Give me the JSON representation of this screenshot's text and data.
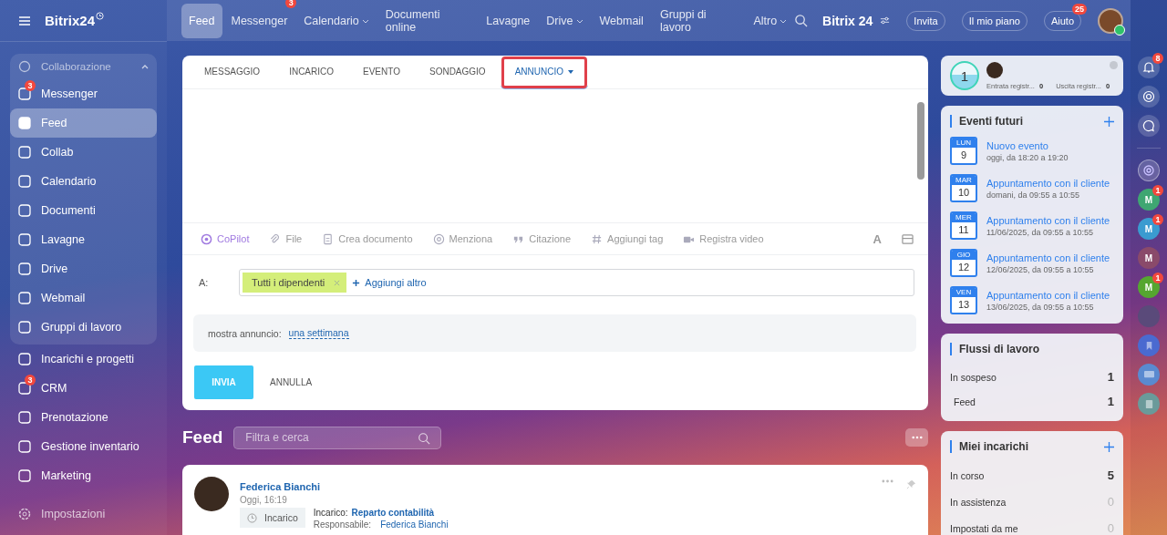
{
  "logo": {
    "text": "Bitrix24"
  },
  "top_nav": [
    {
      "label": "Feed",
      "selected": true
    },
    {
      "label": "Messenger",
      "selected": false,
      "badge": "3"
    },
    {
      "label": "Calendario",
      "selected": false,
      "dropdown": true
    },
    {
      "label": "Documenti online",
      "selected": false
    },
    {
      "label": "Lavagne",
      "selected": false
    },
    {
      "label": "Drive",
      "selected": false,
      "dropdown": true
    },
    {
      "label": "Webmail",
      "selected": false
    },
    {
      "label": "Gruppi di lavoro",
      "selected": false
    },
    {
      "label": "Altro",
      "selected": false,
      "dropdown": true
    }
  ],
  "header": {
    "brand": "Bitrix 24",
    "buttons": [
      {
        "label": "Invita"
      },
      {
        "label": "Il mio piano"
      },
      {
        "label": "Aiuto",
        "badge": "25"
      }
    ]
  },
  "sidebar": {
    "group": {
      "label": "Collaborazione",
      "expanded": true,
      "items": [
        {
          "label": "Messenger",
          "selected": false,
          "badge": "3"
        },
        {
          "label": "Feed",
          "selected": true
        },
        {
          "label": "Collab",
          "selected": false
        },
        {
          "label": "Calendario",
          "selected": false
        },
        {
          "label": "Documenti",
          "selected": false
        },
        {
          "label": "Lavagne",
          "selected": false
        },
        {
          "label": "Drive",
          "selected": false
        },
        {
          "label": "Webmail",
          "selected": false
        },
        {
          "label": "Gruppi di lavoro",
          "selected": false
        }
      ]
    },
    "items": [
      {
        "label": "Incarichi e progetti",
        "selected": false
      },
      {
        "label": "CRM",
        "selected": false,
        "badge": "3"
      },
      {
        "label": "Prenotazione",
        "selected": false
      },
      {
        "label": "Gestione inventario",
        "selected": false
      },
      {
        "label": "Marketing",
        "selected": false
      }
    ],
    "settings": "Impostazioni"
  },
  "composer": {
    "tabs": [
      {
        "label": "MESSAGGIO",
        "selected": false
      },
      {
        "label": "INCARICO",
        "selected": false
      },
      {
        "label": "EVENTO",
        "selected": false
      },
      {
        "label": "SONDAGGIO",
        "selected": false
      },
      {
        "label": "ANNUNCIO",
        "selected": true,
        "dropdown": true
      }
    ],
    "tools": [
      {
        "label": "CoPilot",
        "kind": "copilot"
      },
      {
        "label": "File",
        "kind": "file"
      },
      {
        "label": "Crea documento",
        "kind": "doc"
      },
      {
        "label": "Menziona",
        "kind": "mention"
      },
      {
        "label": "Citazione",
        "kind": "quote"
      },
      {
        "label": "Aggiungi tag",
        "kind": "tag"
      },
      {
        "label": "Registra video",
        "kind": "video"
      }
    ],
    "format_key": "A",
    "recipients": {
      "label": "A:",
      "chips": [
        "Tutti i dipendenti"
      ],
      "add": "Aggiungi altro"
    },
    "duration": {
      "label": "mostra annuncio:",
      "value": "una settimana"
    },
    "send": "INVIA",
    "cancel": "ANNULLA"
  },
  "feed": {
    "title": "Feed",
    "search": {
      "placeholder": "Filtra e cerca"
    },
    "post": {
      "author": "Federica Bianchi",
      "time": "Oggi, 16:19",
      "tag": "Incarico",
      "task_label": "Incarico:",
      "task_link": "Reparto contabilità",
      "responsible_label": "Responsabile:",
      "responsible": "Federica Bianchi"
    }
  },
  "timeman": {
    "count": "1",
    "stats": [
      {
        "label": "Entrata registr...",
        "value": "0"
      },
      {
        "label": "Uscita registr...",
        "value": "0"
      }
    ]
  },
  "events": {
    "title": "Eventi futuri",
    "items": [
      {
        "dow": "LUN",
        "day": "9",
        "title": "Nuovo evento",
        "time": "oggi, da 18:20 a 19:20"
      },
      {
        "dow": "MAR",
        "day": "10",
        "title": "Appuntamento con il cliente",
        "time": "domani, da 09:55 a 10:55"
      },
      {
        "dow": "MER",
        "day": "11",
        "title": "Appuntamento con il cliente",
        "time": "11/06/2025, da 09:55 a 10:55"
      },
      {
        "dow": "GIO",
        "day": "12",
        "title": "Appuntamento con il cliente",
        "time": "12/06/2025, da 09:55 a 10:55"
      },
      {
        "dow": "VEN",
        "day": "13",
        "title": "Appuntamento con il cliente",
        "time": "13/06/2025, da 09:55 a 10:55"
      }
    ]
  },
  "workflows": {
    "title": "Flussi di lavoro",
    "rows": [
      {
        "label": "In sospeso",
        "count": "1",
        "sub": false
      },
      {
        "label": "Feed",
        "count": "1",
        "sub": true
      }
    ]
  },
  "tasks": {
    "title": "Miei incarichi",
    "rows": [
      {
        "label": "In corso",
        "count": "5",
        "zero": false
      },
      {
        "label": "In assistenza",
        "count": "0",
        "zero": true
      },
      {
        "label": "Impostati da me",
        "count": "0",
        "zero": true
      }
    ]
  },
  "rail": {
    "bell_badge": "8",
    "chats": [
      {
        "letter": "M",
        "color": "#3fa672",
        "badge": "1"
      },
      {
        "letter": "M",
        "color": "#3a9bd0",
        "badge": "1"
      },
      {
        "letter": "M",
        "color": "#8a4a6a"
      },
      {
        "letter": "M",
        "color": "#55a630",
        "badge": "1"
      }
    ]
  }
}
